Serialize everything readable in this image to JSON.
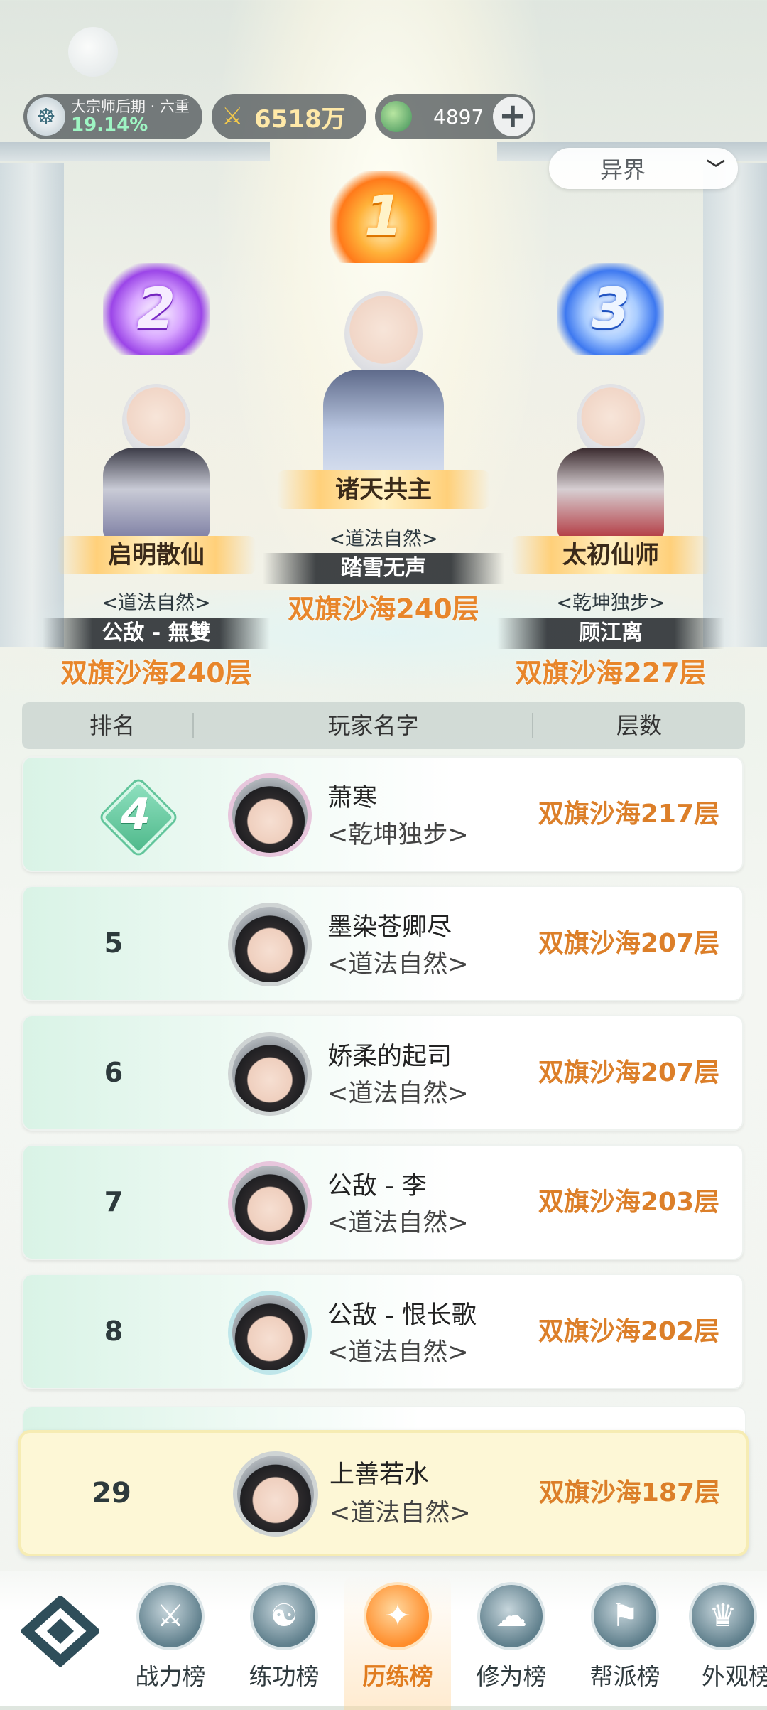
{
  "topbar": {
    "realm": "大宗师后期 · 六重",
    "realm_percent": "19.14%",
    "gold": "6518万",
    "jade": "4897",
    "plus": "+"
  },
  "filter": {
    "selected": "异界",
    "chevron": "chevron-down-icon"
  },
  "podium": {
    "first": {
      "rank": "1",
      "title": "诸天共主",
      "sect": "<道法自然>",
      "name": "踏雪无声",
      "floor": "双旗沙海240层"
    },
    "second": {
      "rank": "2",
      "title": "启明散仙",
      "sect": "<道法自然>",
      "name": "公敌 - 無雙",
      "floor": "双旗沙海240层"
    },
    "third": {
      "rank": "3",
      "title": "太初仙师",
      "sect": "<乾坤独步>",
      "name": "顾江离",
      "floor": "双旗沙海227层"
    }
  },
  "table": {
    "headers": {
      "rank": "排名",
      "name": "玩家名字",
      "floor": "层数"
    },
    "rows": [
      {
        "rank": "4",
        "name": "萧寒",
        "sect": "<乾坤独步>",
        "floor": "双旗沙海217层"
      },
      {
        "rank": "5",
        "name": "墨染苍卿尽",
        "sect": "<道法自然>",
        "floor": "双旗沙海207层"
      },
      {
        "rank": "6",
        "name": "娇柔的起司",
        "sect": "<道法自然>",
        "floor": "双旗沙海207层"
      },
      {
        "rank": "7",
        "name": "公敌 - 李",
        "sect": "<道法自然>",
        "floor": "双旗沙海203层"
      },
      {
        "rank": "8",
        "name": "公敌 - 恨长歌",
        "sect": "<道法自然>",
        "floor": "双旗沙海202层"
      }
    ]
  },
  "my_rank": {
    "rank": "29",
    "name": "上善若水",
    "sect": "<道法自然>",
    "floor": "双旗沙海187层"
  },
  "nav": {
    "items": [
      {
        "label": "战力榜",
        "icon": "swords-icon"
      },
      {
        "label": "练功榜",
        "icon": "yin-yang-icon"
      },
      {
        "label": "历练榜",
        "icon": "star-compass-icon"
      },
      {
        "label": "修为榜",
        "icon": "cloud-hat-icon"
      },
      {
        "label": "帮派榜",
        "icon": "banner-icon"
      },
      {
        "label": "外观榜",
        "icon": "costume-icon"
      }
    ],
    "active_index": 2
  },
  "colors": {
    "accent_orange": "#e8862b",
    "row_green": "#d9f3e6",
    "my_row_yellow": "#fdf7d6",
    "realm_green": "#9ef5c3"
  }
}
